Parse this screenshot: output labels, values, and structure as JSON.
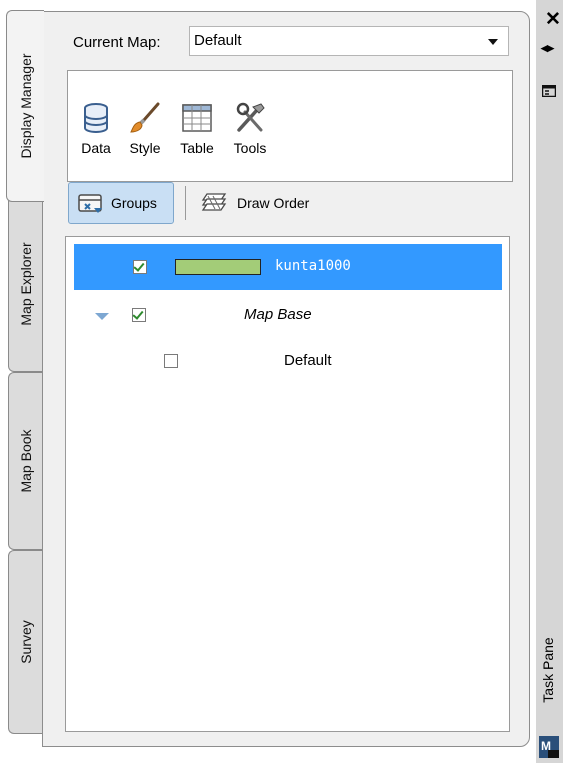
{
  "tabs": [
    {
      "label": "Display Manager",
      "active": true
    },
    {
      "label": "Map Explorer",
      "active": false
    },
    {
      "label": "Map Book",
      "active": false
    },
    {
      "label": "Survey",
      "active": false
    }
  ],
  "current_map": {
    "label": "Current Map:",
    "value": "Default"
  },
  "tools": [
    {
      "label": "Data",
      "icon": "database-icon"
    },
    {
      "label": "Style",
      "icon": "brush-icon"
    },
    {
      "label": "Table",
      "icon": "table-icon"
    },
    {
      "label": "Tools",
      "icon": "tools-icon"
    }
  ],
  "view_buttons": {
    "groups": "Groups",
    "draw_order": "Draw Order"
  },
  "layers": [
    {
      "name": "kunta1000",
      "checked": true,
      "selected": true,
      "swatch_color": "#a3cc78"
    },
    {
      "name": "Map Base",
      "checked": true,
      "expanded": true,
      "italic": true
    },
    {
      "name": "Default",
      "checked": false
    }
  ],
  "right_strip": {
    "task_pane_label": "Task Pane",
    "close_icon": "close-icon",
    "pin_icon": "pin-icon",
    "properties_icon": "properties-icon"
  },
  "colors": {
    "selection": "#3399ff",
    "panel_bg": "#f0f0f0",
    "groups_button": "#c9dff4"
  }
}
